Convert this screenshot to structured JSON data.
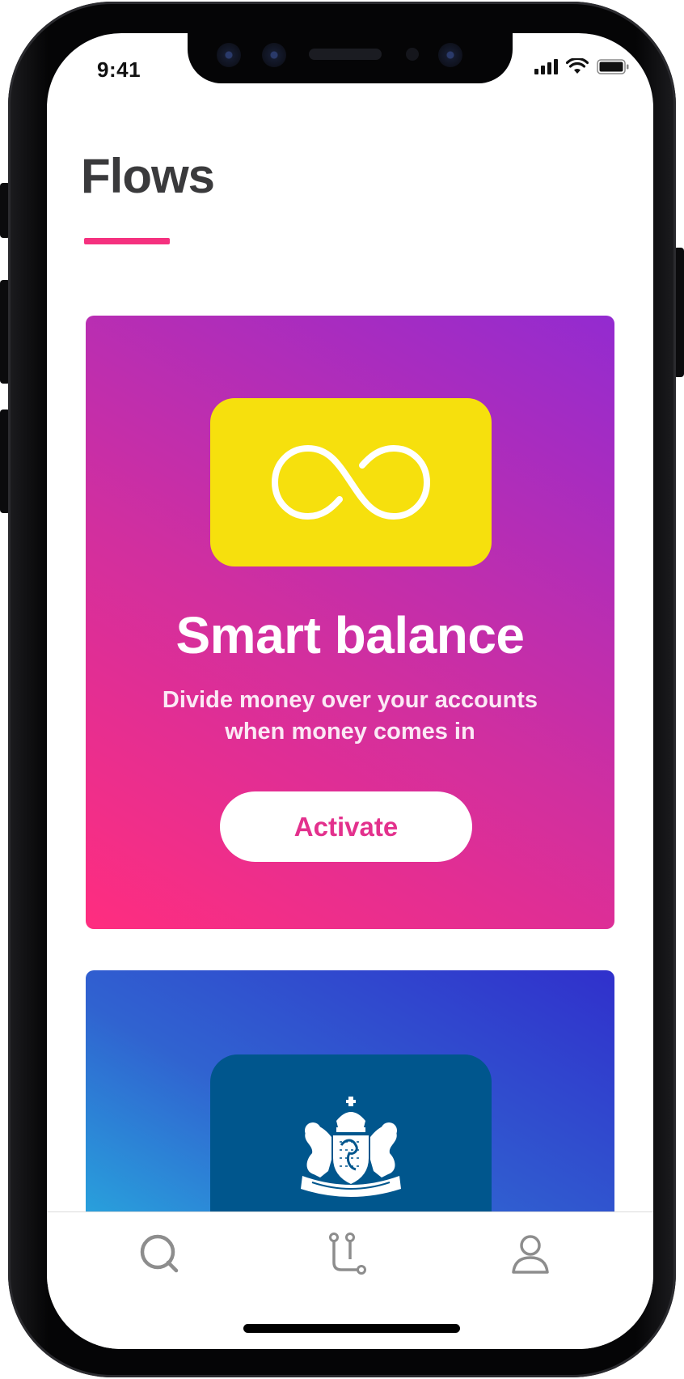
{
  "status_bar": {
    "time": "9:41"
  },
  "header": {
    "title": "Flows"
  },
  "cards": [
    {
      "id": "smart-balance",
      "title": "Smart balance",
      "description": "Divide money over your accounts when money comes in",
      "button_label": "Activate",
      "icon": "infinity-icon",
      "tile_color": "#F6E00D",
      "gradient": [
        "#FF2D7F",
        "#932BD0"
      ]
    },
    {
      "id": "government",
      "icon": "dutch-coat-of-arms-icon",
      "tile_color": "#00568D",
      "gradient": [
        "#24C6E3",
        "#3030CC"
      ]
    }
  ],
  "tab_bar": {
    "items": [
      {
        "name": "search",
        "icon": "search-icon"
      },
      {
        "name": "flows",
        "icon": "flows-icon"
      },
      {
        "name": "profile",
        "icon": "person-icon"
      }
    ]
  },
  "colors": {
    "accent": "#F5317F",
    "title_text": "#3A3A3C"
  }
}
